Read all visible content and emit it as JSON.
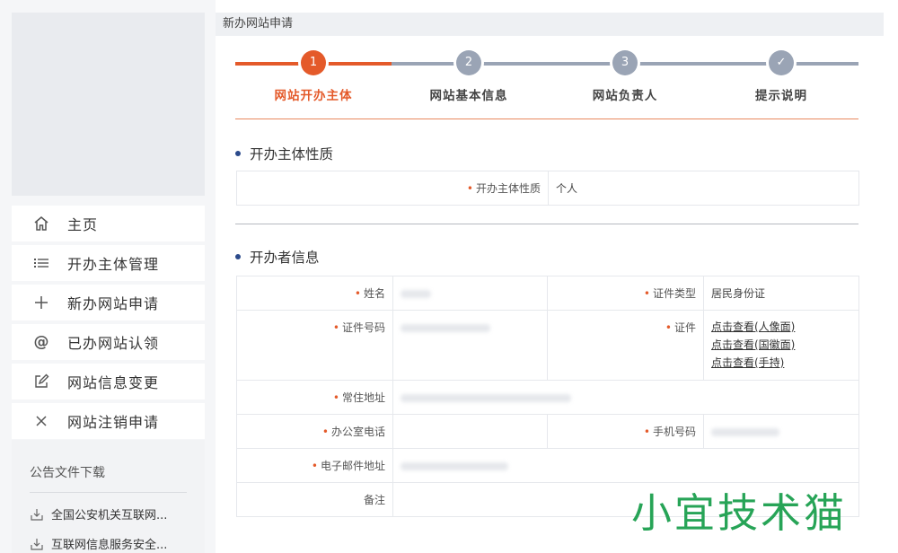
{
  "sidebar": {
    "menu": [
      {
        "label": "主页",
        "icon": "home-icon"
      },
      {
        "label": "开办主体管理",
        "icon": "list-icon"
      },
      {
        "label": "新办网站申请",
        "icon": "plus-icon"
      },
      {
        "label": "已办网站认领",
        "icon": "at-icon"
      },
      {
        "label": "网站信息变更",
        "icon": "edit-icon"
      },
      {
        "label": "网站注销申请",
        "icon": "close-icon"
      }
    ],
    "notice": {
      "title": "公告文件下载",
      "files": [
        "全国公安机关互联网...",
        "互联网信息服务安全..."
      ]
    }
  },
  "main": {
    "header": "新办网站申请",
    "steps": [
      {
        "num": "1",
        "label": "网站开办主体",
        "active": true
      },
      {
        "num": "2",
        "label": "网站基本信息",
        "active": false
      },
      {
        "num": "3",
        "label": "网站负责人",
        "active": false
      },
      {
        "num": "✓",
        "label": "提示说明",
        "active": false
      }
    ],
    "section1": {
      "title": "开办主体性质",
      "label": "开办主体性质",
      "value": "个人"
    },
    "section2": {
      "title": "开办者信息",
      "name_label": "姓名",
      "id_type_label": "证件类型",
      "id_type_value": "居民身份证",
      "id_number_label": "证件号码",
      "id_doc_label": "证件",
      "id_links": [
        "点击查看(人像面)",
        "点击查看(国徽面)",
        "点击查看(手持)"
      ],
      "address_label": "常住地址",
      "office_phone_label": "办公室电话",
      "mobile_label": "手机号码",
      "email_label": "电子邮件地址",
      "remark_label": "备注"
    }
  },
  "watermark": "小宜技术猫",
  "colors": {
    "accent": "#e45a2a",
    "step_gray": "#9aa4b5",
    "dot": "#2b4a8b",
    "watermark": "#27a457"
  }
}
